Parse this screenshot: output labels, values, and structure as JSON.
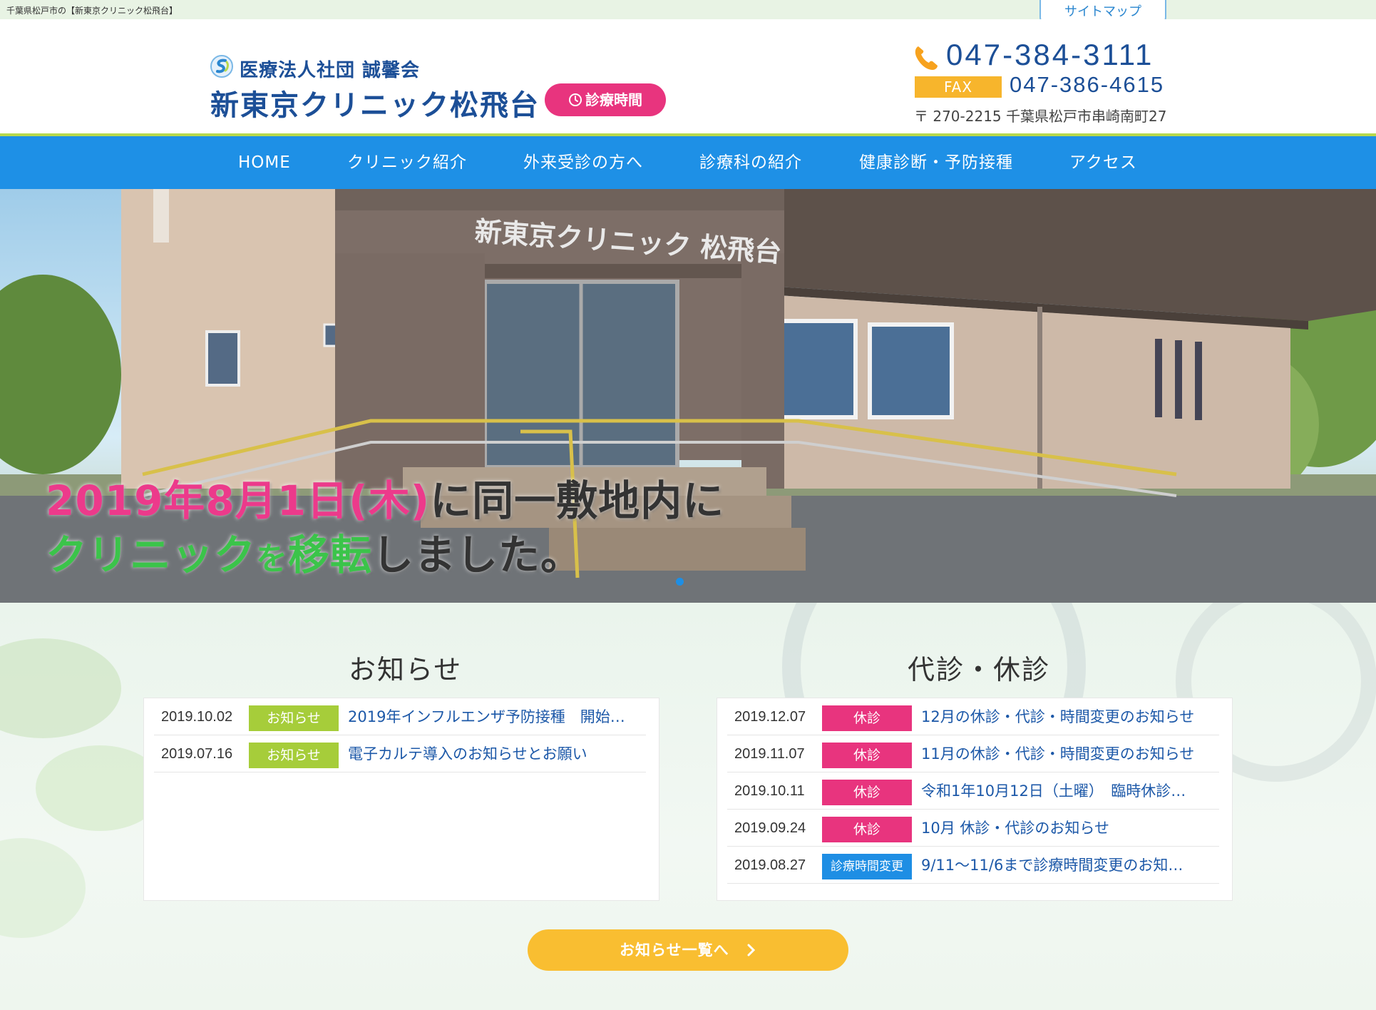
{
  "topbar": {
    "seo_text": "千葉県松戸市の【新東京クリニック松飛台】",
    "sitemap_label": "サイトマップ"
  },
  "header": {
    "corp_name": "医療法人社団 誠馨会",
    "clinic_name": "新東京クリニック松飛台",
    "hours_label": "診療時間",
    "tel": "047-384-3111",
    "fax_label": "FAX",
    "fax": "047-386-4615",
    "address": "〒 270-2215 千葉県松戸市串崎南町27"
  },
  "nav": {
    "items": [
      {
        "label": "HOME"
      },
      {
        "label": "クリニック紹介"
      },
      {
        "label": "外来受診の方へ"
      },
      {
        "label": "診療科の紹介"
      },
      {
        "label": "健康診断・予防接種"
      },
      {
        "label": "アクセス"
      }
    ]
  },
  "hero": {
    "sign": "新東京クリニック 松飛台",
    "line1_pink": "2019年8月1日(木)",
    "line1_dark": "に同一敷地内に",
    "line2_green1": "クリニック",
    "line2_pink": "を",
    "line2_green2": "移転",
    "line2_dark": "しました。"
  },
  "news": {
    "title": "お知らせ",
    "items": [
      {
        "date": "2019.10.02",
        "badge": "お知らせ",
        "title": "2019年インフルエンザ予防接種　開始…"
      },
      {
        "date": "2019.07.16",
        "badge": "お知らせ",
        "title": "電子カルテ導入のお知らせとお願い"
      }
    ]
  },
  "closures": {
    "title": "代診・休診",
    "items": [
      {
        "date": "2019.12.07",
        "badge": "休診",
        "title": "12月の休診・代診・時間変更のお知らせ"
      },
      {
        "date": "2019.11.07",
        "badge": "休診",
        "title": "11月の休診・代診・時間変更のお知らせ"
      },
      {
        "date": "2019.10.11",
        "badge": "休診",
        "title": "令和1年10月12日（土曜）　臨時休診…"
      },
      {
        "date": "2019.09.24",
        "badge": "休診",
        "title": "10月 休診・代診のお知らせ"
      },
      {
        "date": "2019.08.27",
        "badge": "診療時間変更",
        "title": "9/11～11/6まで診療時間変更のお知…"
      }
    ]
  },
  "more_button": "お知らせ一覧へ",
  "colors": {
    "brand_blue": "#1e90e6",
    "navy": "#1c4f97",
    "pink": "#e8347e",
    "green": "#a6cd3a",
    "yellow": "#f9be31"
  }
}
